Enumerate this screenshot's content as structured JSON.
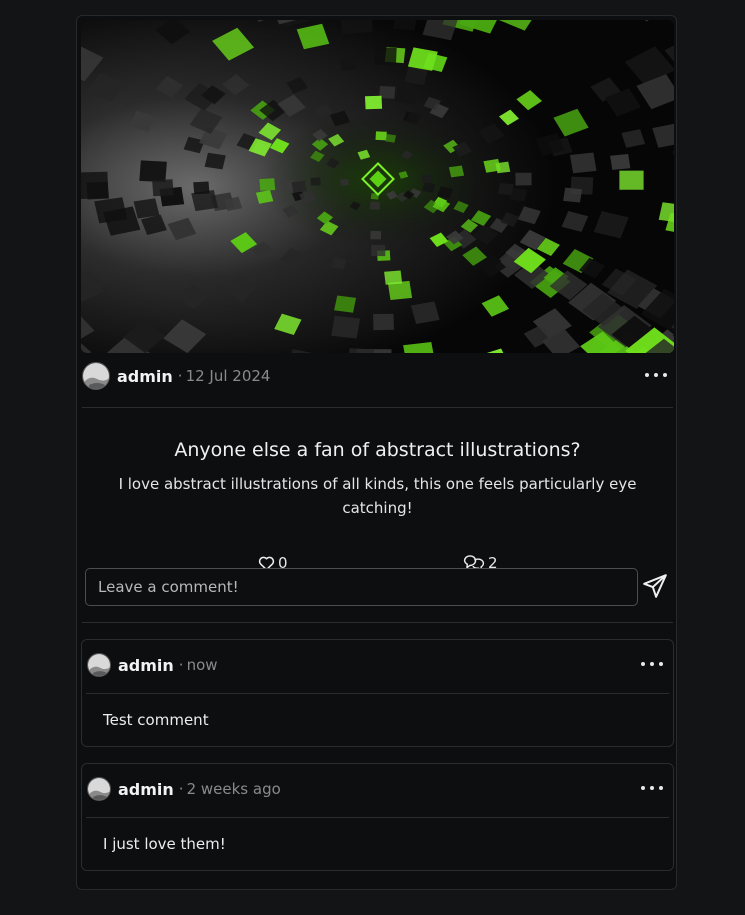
{
  "post": {
    "author": "admin",
    "separator": "·",
    "date": "12 Jul 2024",
    "title": "Anyone else a fan of abstract illustrations?",
    "body": "I love abstract illustrations of all kinds, this one feels particularly eye catching!",
    "likes": "0",
    "comments_count": "2",
    "image_icon": "abstract-green-cubes-image"
  },
  "comment_box": {
    "placeholder": "Leave a comment!"
  },
  "comments": [
    {
      "author": "admin",
      "separator": "·",
      "time": "now",
      "text": "Test comment"
    },
    {
      "author": "admin",
      "separator": "·",
      "time": "2 weeks ago",
      "text": "I just love them!"
    }
  ],
  "colors": {
    "background": "#131416",
    "card": "#0d0e10",
    "accent": "#6fe01c"
  }
}
